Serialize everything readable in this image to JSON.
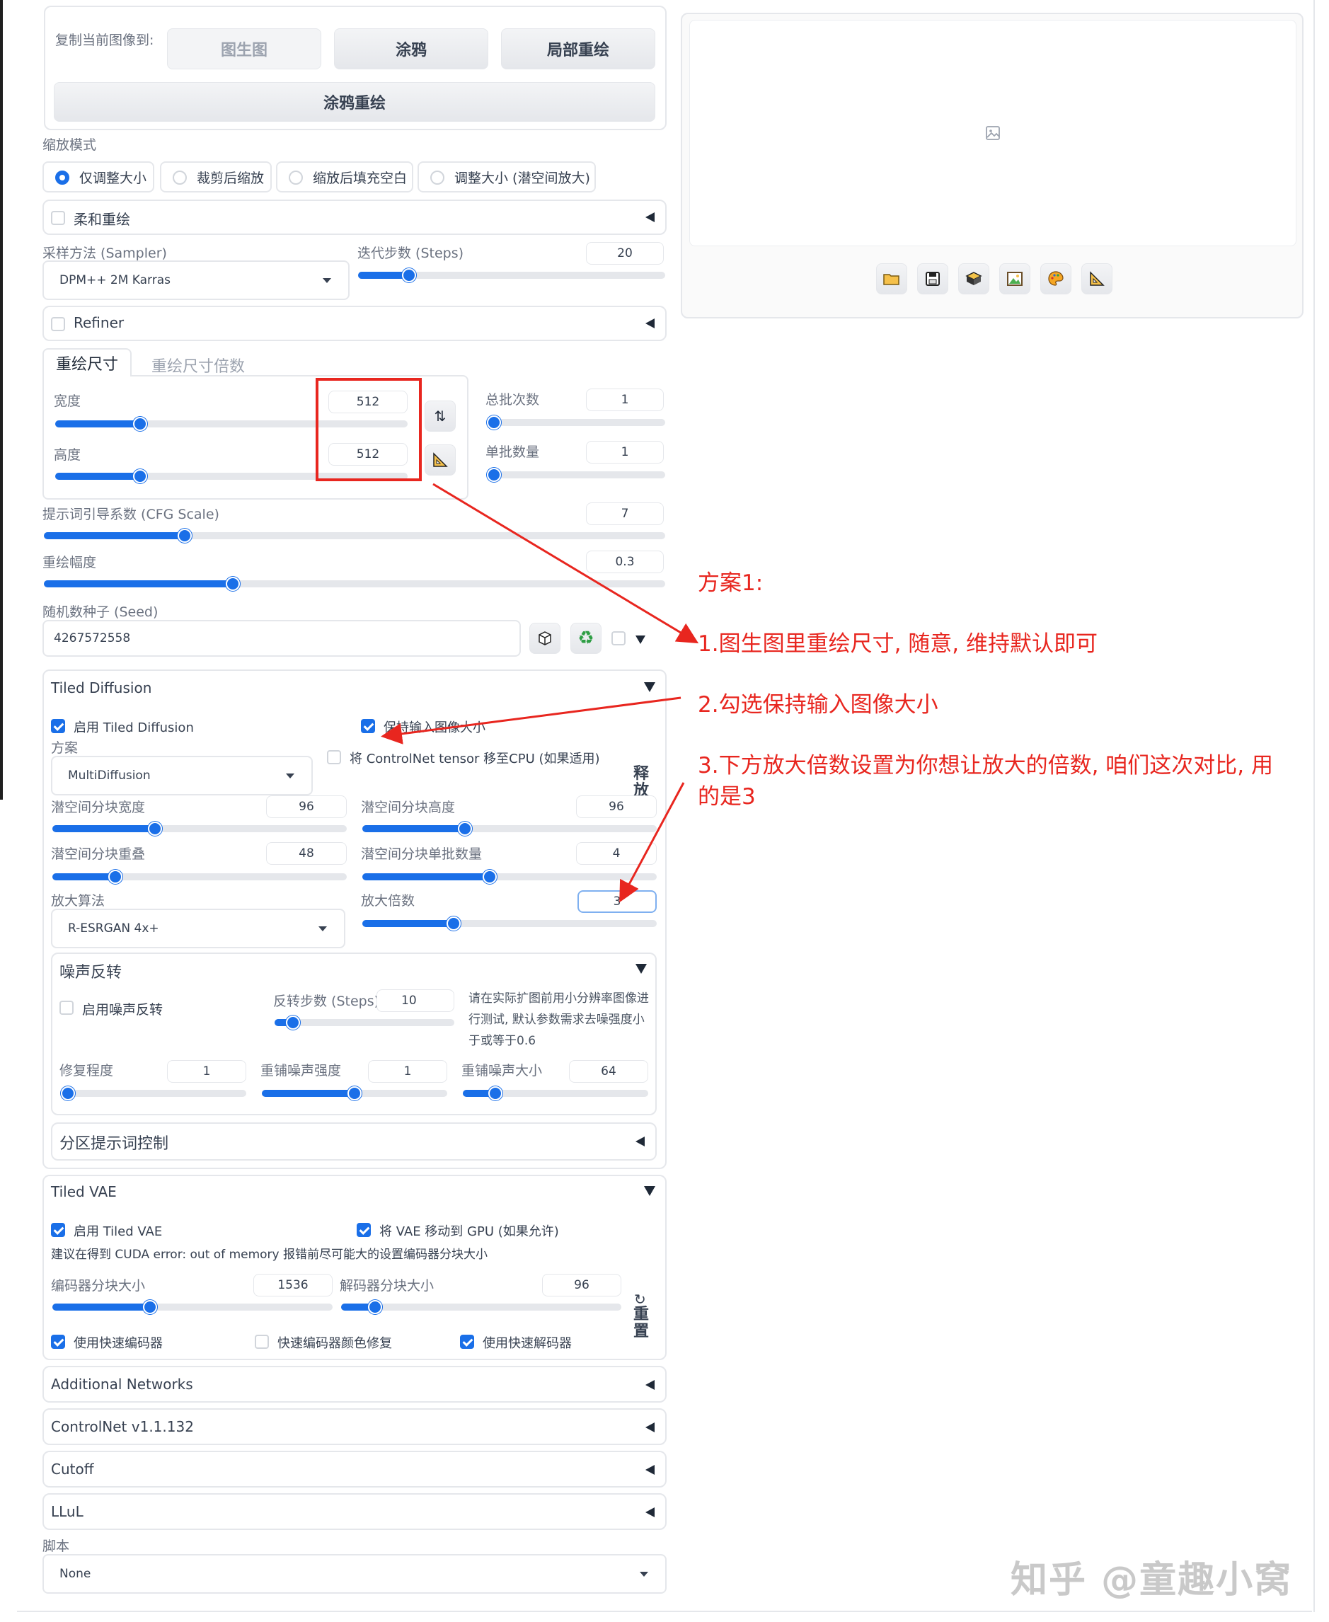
{
  "copy_section": {
    "label": "复制当前图像到:",
    "buttons": [
      "图生图",
      "涂鸦",
      "局部重绘"
    ],
    "wide_button": "涂鸦重绘"
  },
  "resize_mode": {
    "label": "缩放模式",
    "options": [
      "仅调整大小",
      "裁剪后缩放",
      "缩放后填充空白",
      "调整大小 (潜空间放大)"
    ],
    "selected": 0
  },
  "soft_inpaint": {
    "label": "柔和重绘"
  },
  "sampler": {
    "label": "采样方法 (Sampler)",
    "value": "DPM++ 2M Karras"
  },
  "steps": {
    "label": "迭代步数 (Steps)",
    "value": "20",
    "fraction": 0.15
  },
  "refiner": {
    "label": "Refiner"
  },
  "size_tabs": [
    "重绘尺寸",
    "重绘尺寸倍数"
  ],
  "width": {
    "label": "宽度",
    "value": "512",
    "fraction": 0.23
  },
  "height": {
    "label": "高度",
    "value": "512",
    "fraction": 0.23
  },
  "batch_count": {
    "label": "总批次数",
    "value": "1",
    "fraction": 0.0
  },
  "batch_size": {
    "label": "单批数量",
    "value": "1",
    "fraction": 0.0
  },
  "cfg": {
    "label": "提示词引导系数 (CFG Scale)",
    "value": "7",
    "fraction": 0.22
  },
  "denoise": {
    "label": "重绘幅度",
    "value": "0.3",
    "fraction": 0.3
  },
  "seed": {
    "label": "随机数种子 (Seed)",
    "value": "4267572558"
  },
  "tiled_diffusion": {
    "title": "Tiled Diffusion",
    "enable_label": "启用 Tiled Diffusion",
    "keep_size_label": "保持输入图像大小",
    "method_label": "方案",
    "method_value": "MultiDiffusion",
    "controlnet_cpu_label": "将 ControlNet tensor 移至CPU (如果适用)",
    "release_label": "释放",
    "tile_width": {
      "label": "潜空间分块宽度",
      "value": "96",
      "fraction": 0.34
    },
    "tile_height": {
      "label": "潜空间分块高度",
      "value": "96",
      "fraction": 0.34
    },
    "tile_overlap": {
      "label": "潜空间分块重叠",
      "value": "48",
      "fraction": 0.2
    },
    "tile_batch": {
      "label": "潜空间分块单批数量",
      "value": "4",
      "fraction": 0.43
    },
    "upscaler_label": "放大算法",
    "upscaler_value": "R-ESRGAN 4x+",
    "scale": {
      "label": "放大倍数",
      "value": "3",
      "fraction": 0.3
    }
  },
  "noise_inversion": {
    "title": "噪声反转",
    "enable_label": "启用噪声反转",
    "steps": {
      "label": "反转步数 (Steps)",
      "value": "10",
      "fraction": 0.07
    },
    "note": "请在实际扩图前用小分辨率图像进行测试, 默认参数需求去噪强度小于或等于0.6",
    "retouch": {
      "label": "修复程度",
      "value": "1",
      "fraction": 0.0
    },
    "renoise_strength": {
      "label": "重铺噪声强度",
      "value": "1",
      "fraction": 0.5
    },
    "renoise_size": {
      "label": "重铺噪声大小",
      "value": "64",
      "fraction": 0.15
    }
  },
  "region_prompt": {
    "title": "分区提示词控制"
  },
  "tiled_vae": {
    "title": "Tiled VAE",
    "enable_label": "启用 Tiled VAE",
    "move_gpu_label": "将 VAE 移动到 GPU (如果允许)",
    "hint": "建议在得到 CUDA error: out of memory 报错前尽可能大的设置编码器分块大小",
    "encoder": {
      "label": "编码器分块大小",
      "value": "1536",
      "fraction": 0.34
    },
    "decoder": {
      "label": "解码器分块大小",
      "value": "96",
      "fraction": 0.1
    },
    "reset_label": "重置",
    "fast_encoder": "使用快速编码器",
    "fast_color_fix": "快速编码器颜色修复",
    "fast_decoder": "使用快速解码器"
  },
  "accordions": [
    "Additional Networks",
    "ControlNet v1.1.132",
    "Cutoff",
    "LLuL"
  ],
  "script": {
    "label": "脚本",
    "value": "None"
  },
  "output_tools": [
    "folder-icon",
    "save-icon",
    "zip-icon",
    "image-icon",
    "palette-icon",
    "ruler-icon"
  ],
  "annotations": {
    "heading": "方案1:",
    "line1": "1.图生图里重绘尺寸, 随意, 维持默认即可",
    "line2": "2.勾选保持输入图像大小",
    "line3a": "3.下方放大倍数设置为你想让放大的倍数, 咱们这次对比, 用",
    "line3b": "的是3"
  },
  "watermark": "知乎 @童趣小窝",
  "colors": {
    "accent": "#1a6fe8",
    "annotation": "#e8261f"
  }
}
